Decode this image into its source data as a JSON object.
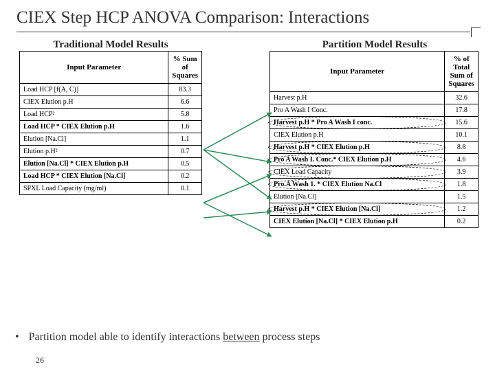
{
  "title": "CIEX Step HCP ANOVA Comparison: Interactions",
  "page_number": "26",
  "left": {
    "subtitle": "Traditional Model Results",
    "col1": "Input Parameter",
    "col2": "% Sum of Squares",
    "rows": [
      {
        "p": "Load HCP [f(A, C)]",
        "v": "83.3",
        "b": false
      },
      {
        "p": "CIEX Elution p.H",
        "v": "6.6",
        "b": false
      },
      {
        "p": "Load HCP²",
        "v": "5.8",
        "b": false
      },
      {
        "p": "Load HCP * CIEX Elution p.H",
        "v": "1.6",
        "b": true
      },
      {
        "p": "Elution [Na.Cl]",
        "v": "1.1",
        "b": false
      },
      {
        "p": "Elution p.H²",
        "v": "0.7",
        "b": false
      },
      {
        "p": "Elution [Na.Cl] * CIEX Elution p.H",
        "v": "0.5",
        "b": true
      },
      {
        "p": "Load HCP * CIEX Elution [Na.Cl]",
        "v": "0.2",
        "b": true
      },
      {
        "p": "SPXL Load Capacity (mg/ml)",
        "v": "0.1",
        "b": false
      }
    ]
  },
  "right": {
    "subtitle": "Partition Model Results",
    "col1": "Input Parameter",
    "col2": "% of Total Sum of Squares",
    "rows": [
      {
        "p": "Harvest p.H",
        "v": "32.6",
        "b": false,
        "e": false
      },
      {
        "p": "Pro A Wash I Conc.",
        "v": "17.8",
        "b": false,
        "e": false
      },
      {
        "p": "Harvest p.H * Pro A Wash I  conc.",
        "v": "15.6",
        "b": true,
        "e": true
      },
      {
        "p": "CIEX Elution p.H",
        "v": "10.1",
        "b": false,
        "e": false
      },
      {
        "p": "Harvest p.H * CIEX Elution p.H",
        "v": "8.8",
        "b": true,
        "e": true
      },
      {
        "p": "Pro A Wash I. Conc.* CIEX Elution p.H",
        "v": "4.6",
        "b": true,
        "e": true
      },
      {
        "p": "CIEX Load Capacity",
        "v": "3.9",
        "b": false,
        "e": true
      },
      {
        "p": "Pro.A Wash 1. * CIEX Elution Na.Cl",
        "v": "1.8",
        "b": true,
        "e": true
      },
      {
        "p": "Elution [Na.Cl]",
        "v": "1.5",
        "b": false,
        "e": false
      },
      {
        "p": "Harvest p.H * CIEX Elution [Na.Cl]",
        "v": "1.2",
        "b": true,
        "e": true
      },
      {
        "p": "CIEX Elution [Na.Cl] * CIEX Elution p.H",
        "v": "0.2",
        "b": true,
        "e": false
      }
    ]
  },
  "bullet": {
    "pre": "Partition model able to identify interactions ",
    "u": "between",
    "post": " process steps"
  }
}
